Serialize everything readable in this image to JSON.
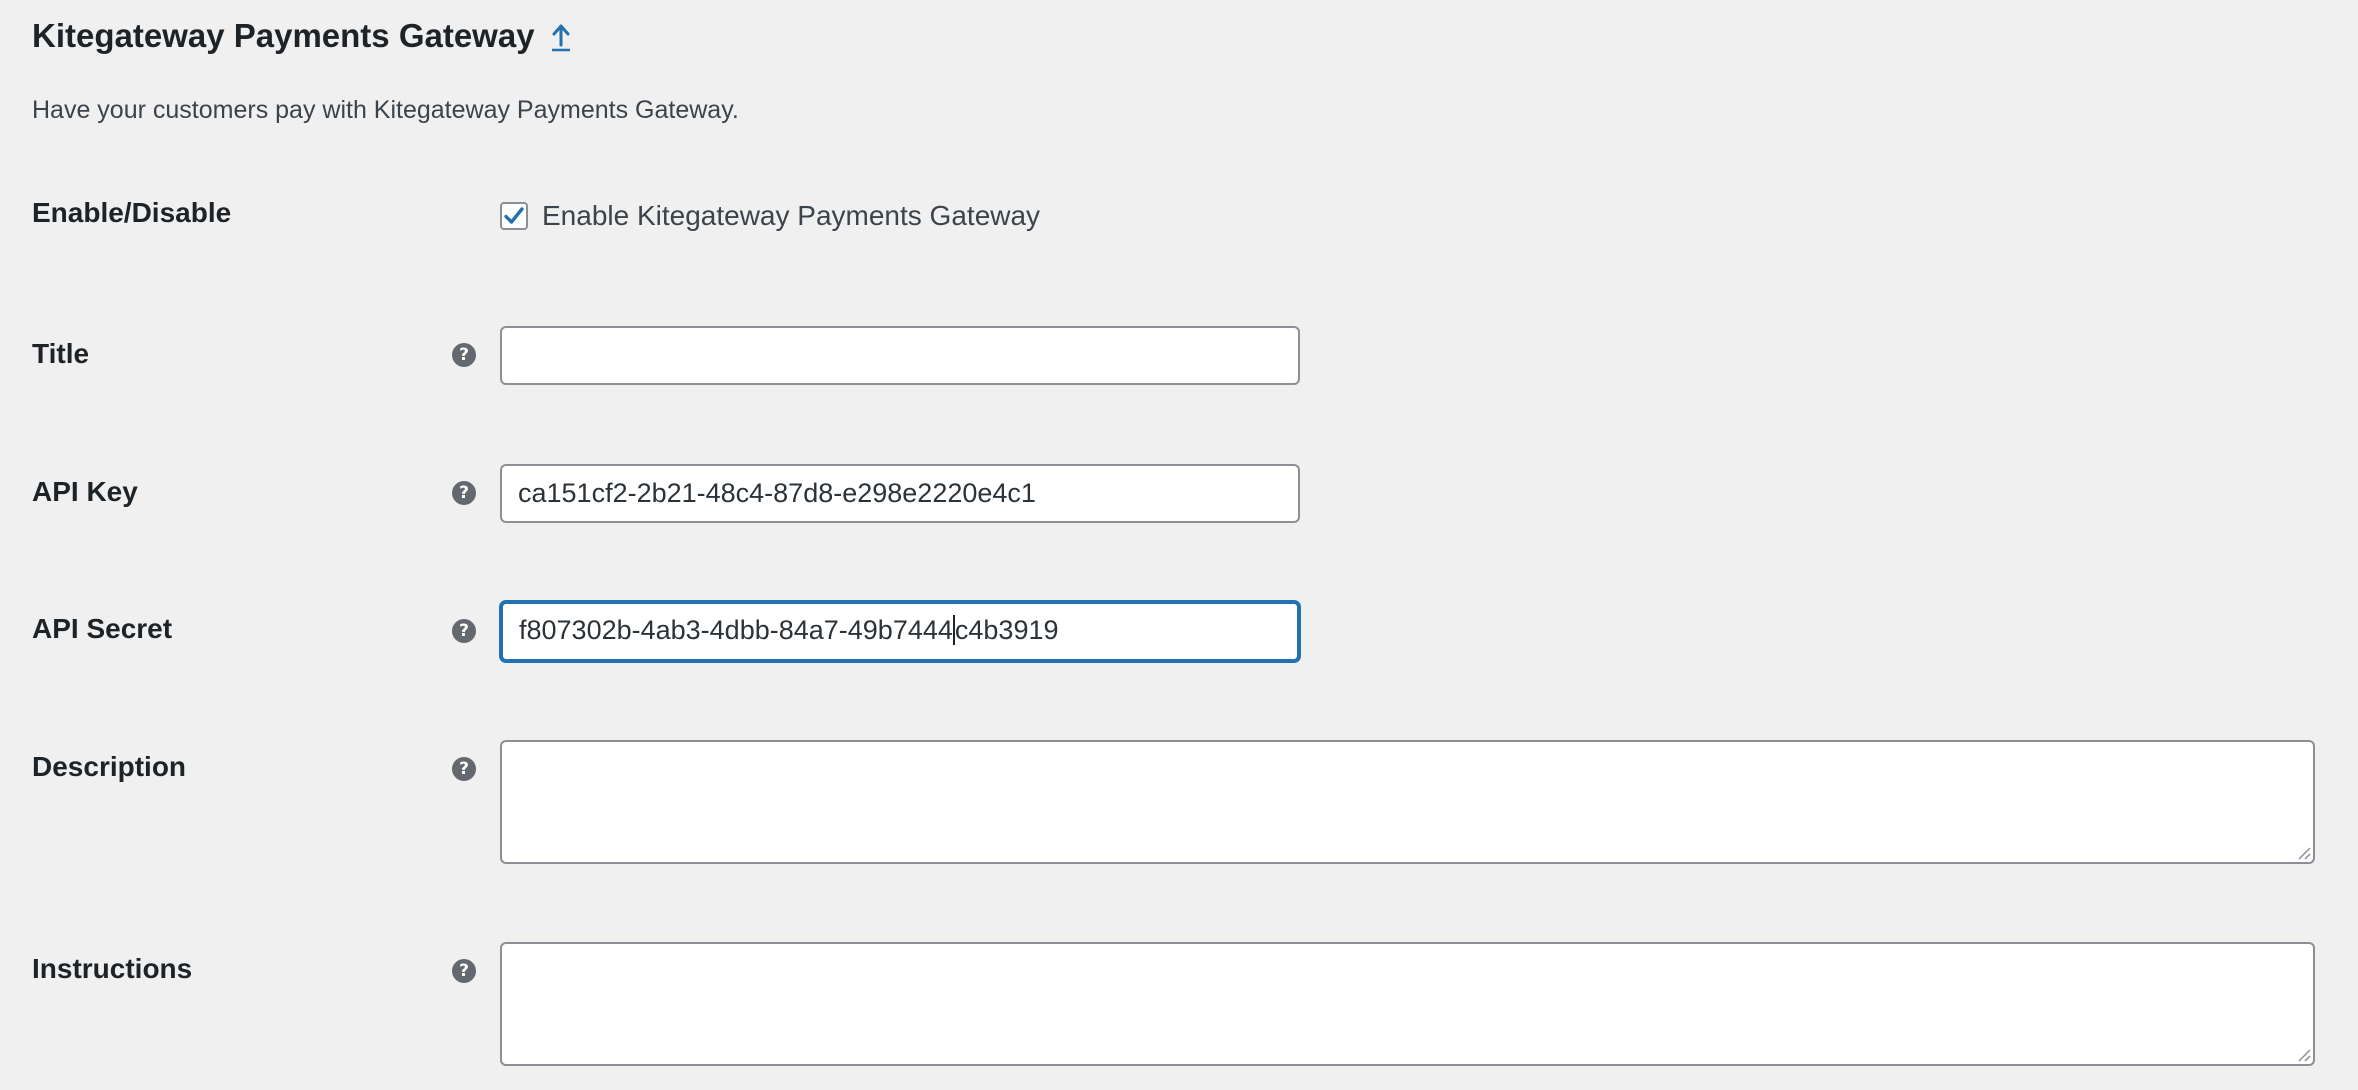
{
  "header": {
    "title": "Kitegateway Payments Gateway",
    "up_icon": "upward-arrow-link-icon"
  },
  "intro": "Have your customers pay with Kitegateway Payments Gateway.",
  "colors": {
    "accent": "#2271b1",
    "background": "#f0f0f1",
    "help_icon": "#646970"
  },
  "fields": {
    "enable": {
      "label": "Enable/Disable",
      "checkbox_label": "Enable Kitegateway Payments Gateway",
      "checked": true
    },
    "title": {
      "label": "Title",
      "value": "",
      "help_icon": "help-tip-icon"
    },
    "api_key": {
      "label": "API Key",
      "value": "ca151cf2-2b21-48c4-87d8-e298e2220e4c1",
      "help_icon": "help-tip-icon"
    },
    "api_secret": {
      "label": "API Secret",
      "value_before_caret": "f807302b-4ab3-4dbb-84a7-49b7444",
      "value_after_caret": "c4b3919",
      "focused": true,
      "help_icon": "help-tip-icon"
    },
    "description": {
      "label": "Description",
      "value": "",
      "help_icon": "help-tip-icon"
    },
    "instructions": {
      "label": "Instructions",
      "value": "",
      "help_icon": "help-tip-icon"
    }
  }
}
